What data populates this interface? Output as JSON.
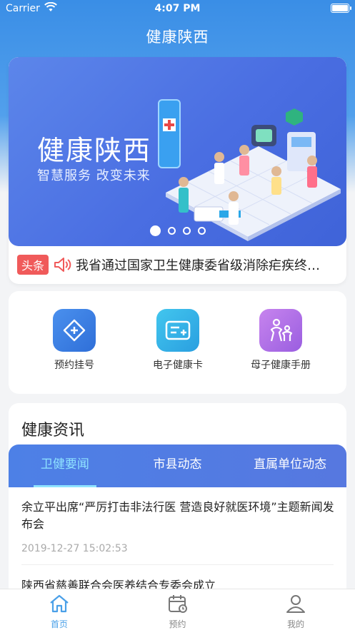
{
  "status_bar": {
    "carrier": "Carrier",
    "time": "4:07 PM"
  },
  "app": {
    "title": "健康陕西"
  },
  "banner": {
    "title": "健康陕西",
    "subtitle": "智慧服务 改变未来",
    "page_count": 4,
    "active_page": 1
  },
  "headline": {
    "tag": "头条",
    "text": "我省通过国家卫生健康委省级消除疟疾终期评估"
  },
  "services": [
    {
      "label": "预约挂号",
      "icon": "appointment-plus-icon",
      "color": "#3d82e6"
    },
    {
      "label": "电子健康卡",
      "icon": "health-card-icon",
      "color": "#33b6e8"
    },
    {
      "label": "母子健康手册",
      "icon": "mother-child-icon",
      "color": "#b36ee6"
    }
  ],
  "news": {
    "section_title": "健康资讯",
    "tabs": [
      "卫健要闻",
      "市县动态",
      "直属单位动态"
    ],
    "active_tab": 0,
    "items": [
      {
        "title": "余立平出席“严厉打击非法行医 营造良好就医环境”主题新闻发布会",
        "date": "2019-12-27 15:02:53"
      },
      {
        "title": "陕西省慈善联合会医养结合专委会成立",
        "date": ""
      }
    ]
  },
  "tabbar": [
    {
      "label": "首页",
      "icon": "home-icon",
      "active": true
    },
    {
      "label": "预约",
      "icon": "calendar-icon",
      "active": false
    },
    {
      "label": "我的",
      "icon": "profile-icon",
      "active": false
    }
  ],
  "colors": {
    "accent": "#4aa0e8",
    "headline_tag": "#f05a5a",
    "tab_active": "#8fe3ff"
  }
}
